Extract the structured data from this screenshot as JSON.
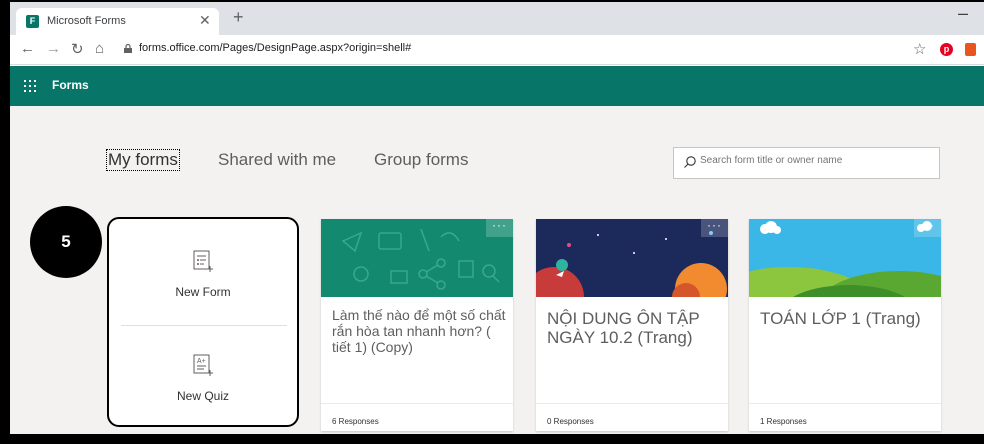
{
  "browser": {
    "tab_title": "Microsoft Forms",
    "url": "forms.office.com/Pages/DesignPage.aspx?origin=shell#",
    "favicon_label": "F"
  },
  "app": {
    "name": "Forms",
    "accent": "#077568"
  },
  "nav": {
    "tabs": [
      {
        "label": "My forms",
        "selected": true
      },
      {
        "label": "Shared with me",
        "selected": false
      },
      {
        "label": "Group forms",
        "selected": false
      }
    ]
  },
  "search": {
    "placeholder": "Search form title or owner name"
  },
  "step_badge": "5",
  "create": {
    "new_form": "New Form",
    "new_quiz": "New Quiz"
  },
  "forms": [
    {
      "title": "Làm thế nào để một số chất rắn hòa tan nhanh hơn? ( tiết 1)  (Copy)",
      "responses": "6 Responses",
      "theme": "teal-doodles"
    },
    {
      "title": "NỘI DUNG ÔN TẬP NGÀY 10.2 (Trang)",
      "responses": "0 Responses",
      "theme": "space"
    },
    {
      "title": "TOÁN LỚP 1 (Trang)",
      "responses": "1 Responses",
      "theme": "green-hills"
    }
  ]
}
